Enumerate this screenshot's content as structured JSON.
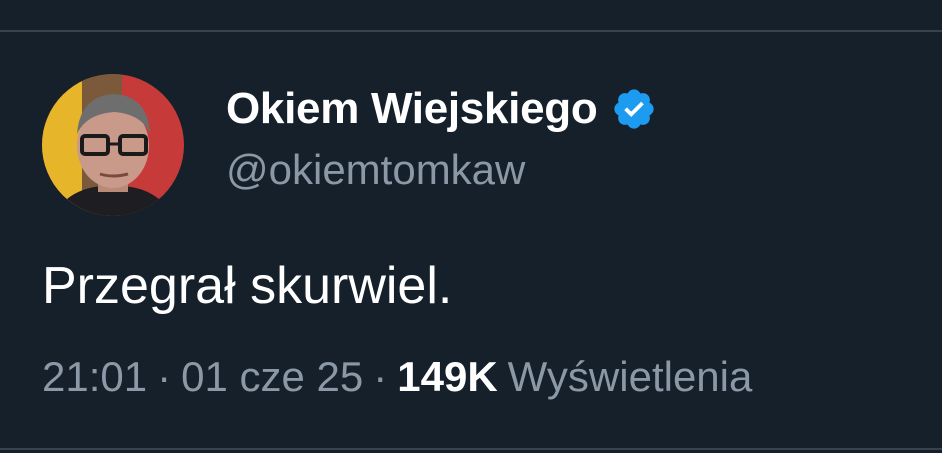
{
  "tweet": {
    "author": {
      "display_name": "Okiem Wiejskiego",
      "handle": "@okiemtomkaw",
      "verified_icon": "verified-badge-icon",
      "verified_color": "#1d9bf0"
    },
    "text": "Przegrał skurwiel.",
    "time": "21:01",
    "date": "01 cze 25",
    "separator": "·",
    "views_count": "149K",
    "views_label": "Wyświetlenia"
  },
  "colors": {
    "background": "#15202b",
    "divider": "#38444d",
    "primary_text": "#ffffff",
    "secondary_text": "#8b98a5"
  }
}
